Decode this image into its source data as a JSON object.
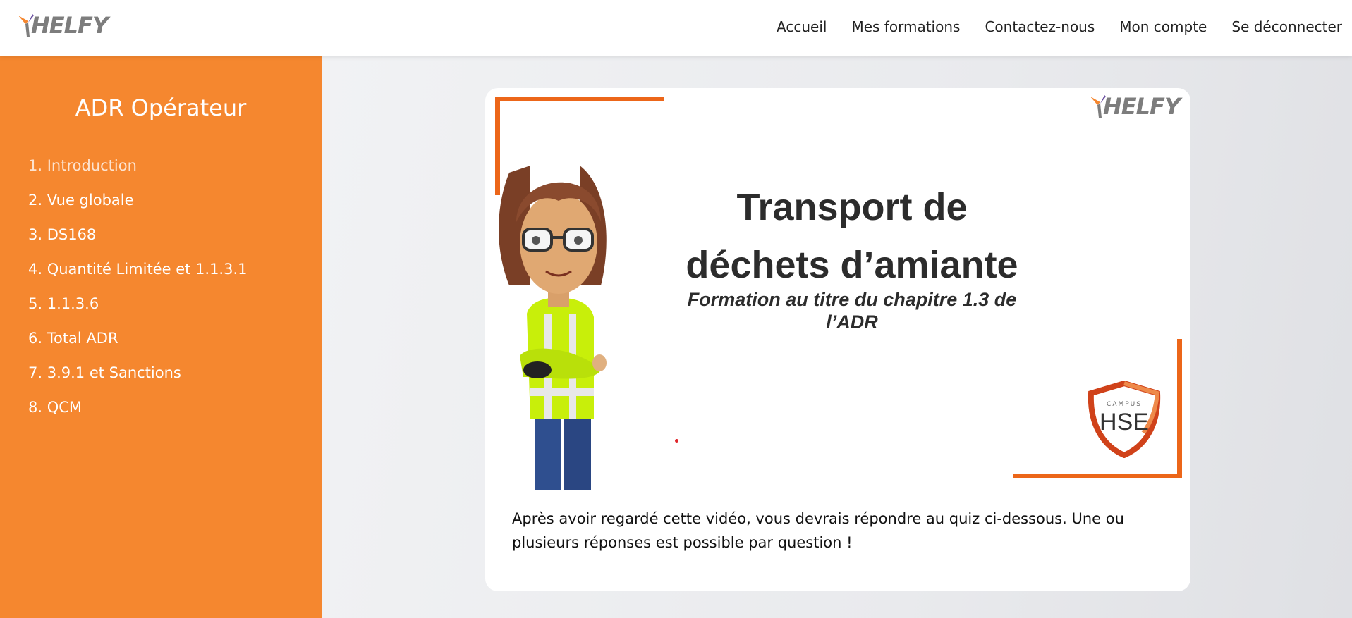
{
  "header": {
    "brand": "HELFY",
    "nav": [
      "Accueil",
      "Mes formations",
      "Contactez-nous",
      "Mon compte",
      "Se déconnecter"
    ]
  },
  "sidebar": {
    "title": "ADR Opérateur",
    "items": [
      {
        "label": "1. Introduction"
      },
      {
        "label": "2. Vue globale"
      },
      {
        "label": "3. DS168"
      },
      {
        "label": "4. Quantité Limitée et 1.1.3.1"
      },
      {
        "label": "5. 1.1.3.6"
      },
      {
        "label": "6. Total ADR"
      },
      {
        "label": "7. 3.9.1 et Sanctions"
      },
      {
        "label": "8. QCM"
      }
    ]
  },
  "video": {
    "brand": "HELFY",
    "title_line1": "Transport de",
    "title_line2": "déchets d’amiante",
    "subtitle": "Formation au titre du chapitre 1.3 de l’ADR",
    "badge_small": "CAMPUS",
    "badge_big": "HSE"
  },
  "main": {
    "caption": "Après avoir regardé cette vidéo, vous devrais répondre au quiz ci-dessous. Une ou plusieurs réponses est possible par question !"
  },
  "colors": {
    "accent": "#f5872f",
    "frame": "#ec6619",
    "logo_gray": "#7d7d7d"
  }
}
